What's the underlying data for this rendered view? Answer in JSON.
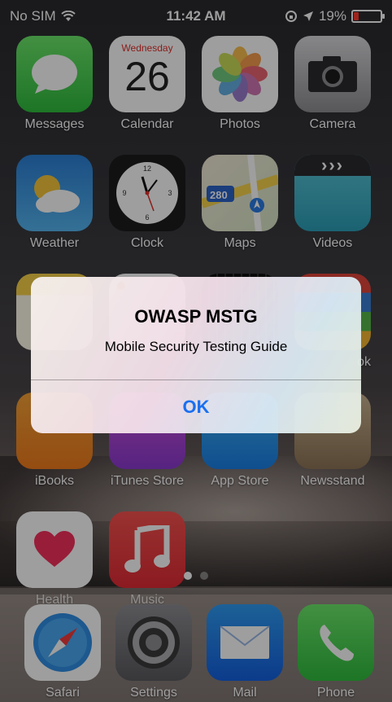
{
  "status_bar": {
    "carrier": "No SIM",
    "time": "11:42 AM",
    "battery": "19%",
    "battery_level": 0.19,
    "battery_color": "#ff3b30"
  },
  "apps": [
    {
      "label": "Messages",
      "icon": "messages-icon"
    },
    {
      "label": "Calendar",
      "icon": "calendar-icon",
      "weekday": "Wednesday",
      "day": "26"
    },
    {
      "label": "Photos",
      "icon": "photos-icon"
    },
    {
      "label": "Camera",
      "icon": "camera-icon"
    },
    {
      "label": "Weather",
      "icon": "weather-icon"
    },
    {
      "label": "Clock",
      "icon": "clock-icon"
    },
    {
      "label": "Maps",
      "icon": "maps-icon",
      "badge": "280"
    },
    {
      "label": "Videos",
      "icon": "videos-icon"
    },
    {
      "label": "",
      "icon": "notes-icon"
    },
    {
      "label": "",
      "icon": "reminders-icon"
    },
    {
      "label": "",
      "icon": "stocks-icon"
    },
    {
      "label": "ok",
      "icon": "passbook-icon"
    },
    {
      "label": "iBooks",
      "icon": "ibooks-icon"
    },
    {
      "label": "iTunes Store",
      "icon": "itunes-store-icon"
    },
    {
      "label": "App Store",
      "icon": "app-store-icon"
    },
    {
      "label": "Newsstand",
      "icon": "newsstand-icon"
    },
    {
      "label": "Health",
      "icon": "health-icon"
    },
    {
      "label": "Music",
      "icon": "music-icon"
    }
  ],
  "page_indicator": {
    "count": 2,
    "active": 0
  },
  "dock": [
    {
      "label": "Safari",
      "icon": "safari-icon"
    },
    {
      "label": "Settings",
      "icon": "settings-icon"
    },
    {
      "label": "Mail",
      "icon": "mail-icon"
    },
    {
      "label": "Phone",
      "icon": "phone-icon"
    }
  ],
  "alert": {
    "title": "OWASP MSTG",
    "message": "Mobile Security Testing Guide",
    "button_label": "OK",
    "button_color": "#1a6ff0"
  }
}
